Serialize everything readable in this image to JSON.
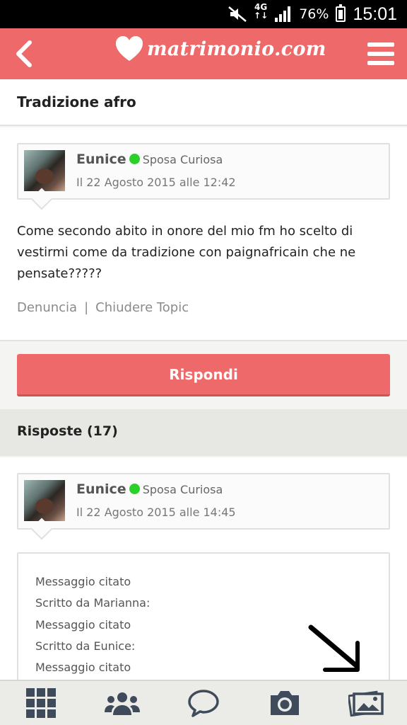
{
  "status_bar": {
    "network": "4G",
    "battery": "76%",
    "time": "15:01"
  },
  "header": {
    "brand": "matrimonio.com"
  },
  "topic": {
    "title": "Tradizione afro"
  },
  "post": {
    "author": "Eunice",
    "role": "Sposa Curiosa",
    "date": "Il 22 Agosto 2015 alle 12:42",
    "text": "Come secondo abito in onore del mio fm ho scelto di vestirmi come da tradizione con paignafricain che ne pensate?????",
    "links": [
      "Denuncia",
      "Chiudere Topic"
    ],
    "link_separator": "|"
  },
  "reply_button": {
    "label": "Rispondi"
  },
  "answers": {
    "heading": "Risposte (17)"
  },
  "reply": {
    "author": "Eunice",
    "role": "Sposa Curiosa",
    "date": "Il 22 Agosto 2015 alle 14:45",
    "quote_lines": [
      "Messaggio citato",
      "Scritto da Marianna:",
      "Messaggio citato",
      "Scritto da Eunice:",
      "Messaggio citato"
    ]
  },
  "bottom_nav": {
    "items": [
      "grid-icon",
      "community-icon",
      "chat-bubble-icon",
      "camera-icon",
      "gallery-icon"
    ]
  },
  "colors": {
    "brand": "#ee6a6a",
    "online": "#2bd02b",
    "background": "#f4f4f2"
  }
}
